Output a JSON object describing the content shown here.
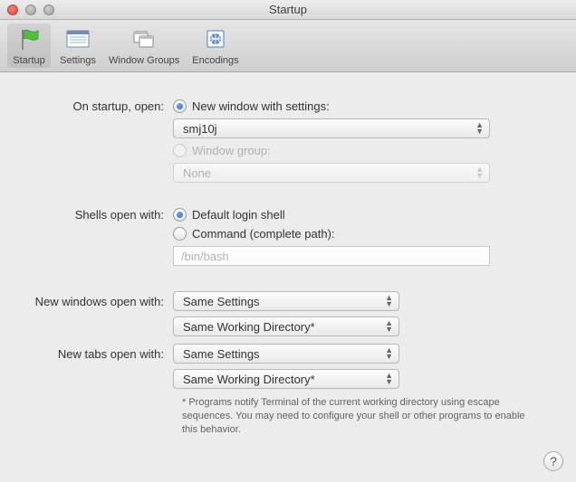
{
  "window": {
    "title": "Startup"
  },
  "toolbar": {
    "items": [
      {
        "label": "Startup"
      },
      {
        "label": "Settings"
      },
      {
        "label": "Window Groups"
      },
      {
        "label": "Encodings"
      }
    ]
  },
  "labels": {
    "on_startup_open": "On startup, open:",
    "shells_open_with": "Shells open with:",
    "new_windows_open_with": "New windows open with:",
    "new_tabs_open_with": "New tabs open with:"
  },
  "startup": {
    "new_window_label": "New window with settings:",
    "settings_popup": "smj10j",
    "window_group_label": "Window group:",
    "window_group_popup": "None"
  },
  "shells": {
    "default_label": "Default login shell",
    "command_label": "Command (complete path):",
    "command_value": "/bin/bash"
  },
  "new_windows": {
    "settings": "Same Settings",
    "dir": "Same Working Directory*"
  },
  "new_tabs": {
    "settings": "Same Settings",
    "dir": "Same Working Directory*"
  },
  "footnote": "* Programs notify Terminal of the current working directory using escape sequences. You may need to configure your shell or other programs to enable this behavior.",
  "help": "?"
}
